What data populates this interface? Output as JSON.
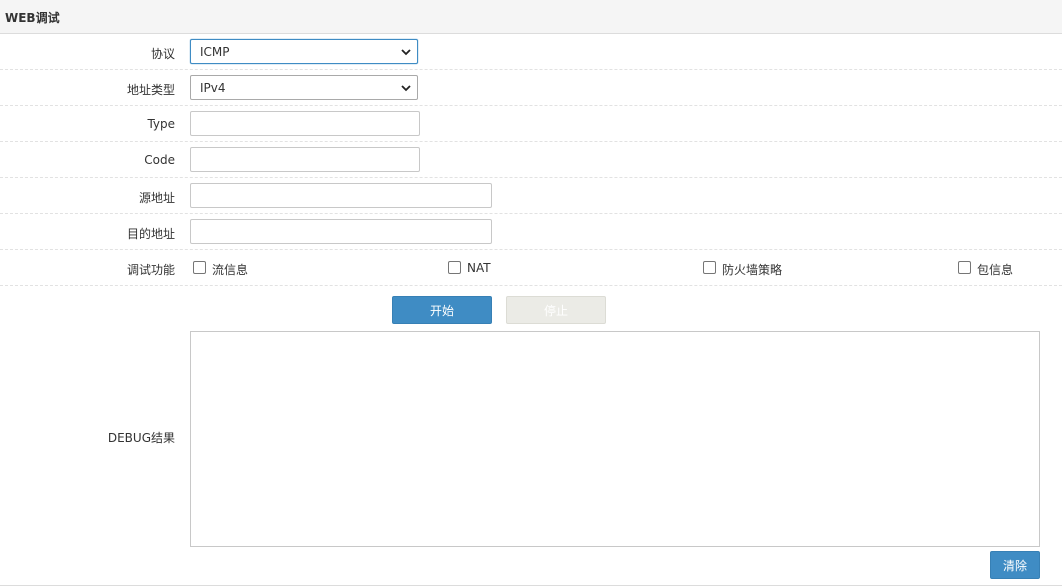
{
  "panel": {
    "title": "WEB调试"
  },
  "form": {
    "protocol": {
      "label": "协议",
      "value": "ICMP"
    },
    "address_type": {
      "label": "地址类型",
      "value": "IPv4"
    },
    "type": {
      "label": "Type",
      "value": ""
    },
    "code": {
      "label": "Code",
      "value": ""
    },
    "source_address": {
      "label": "源地址",
      "value": ""
    },
    "dest_address": {
      "label": "目的地址",
      "value": ""
    },
    "debug_functions": {
      "label": "调试功能",
      "options": [
        {
          "label": "流信息",
          "checked": false
        },
        {
          "label": "NAT",
          "checked": false
        },
        {
          "label": "防火墙策略",
          "checked": false
        },
        {
          "label": "包信息",
          "checked": false
        }
      ]
    }
  },
  "actions": {
    "start_label": "开始",
    "stop_label": "停止"
  },
  "debug": {
    "label": "DEBUG结果",
    "content": "",
    "clear_label": "清除"
  },
  "colors": {
    "primary": "#3f8cc4",
    "disabled": "#ebebe6",
    "header_bg": "#f5f5f5"
  }
}
